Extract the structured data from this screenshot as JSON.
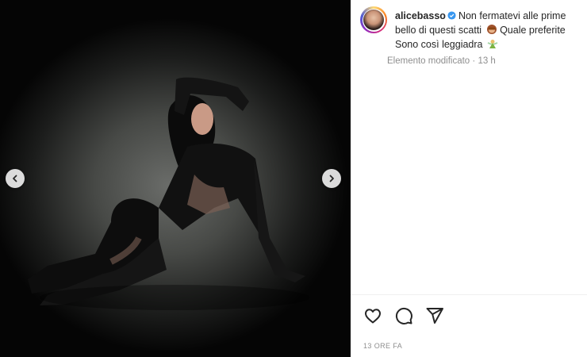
{
  "post": {
    "username": "alicebasso",
    "caption_line1": "Non fermatevi alle prime",
    "caption_line2": "bello di questi scatti",
    "caption_line2b": "Quale preferite",
    "caption_line3": "Sono così leggiadra",
    "edited_label": "Elemento modificato",
    "edited_time": "13 h",
    "timestamp": "13 ORE FA"
  },
  "icons": {
    "verified": "verified-badge-icon",
    "prev": "chevron-left-icon",
    "next": "chevron-right-icon",
    "like": "heart-icon",
    "comment": "comment-icon",
    "share": "share-icon"
  },
  "colors": {
    "verified": "#3897f0",
    "text": "#262626",
    "muted": "#8e8e8e"
  }
}
